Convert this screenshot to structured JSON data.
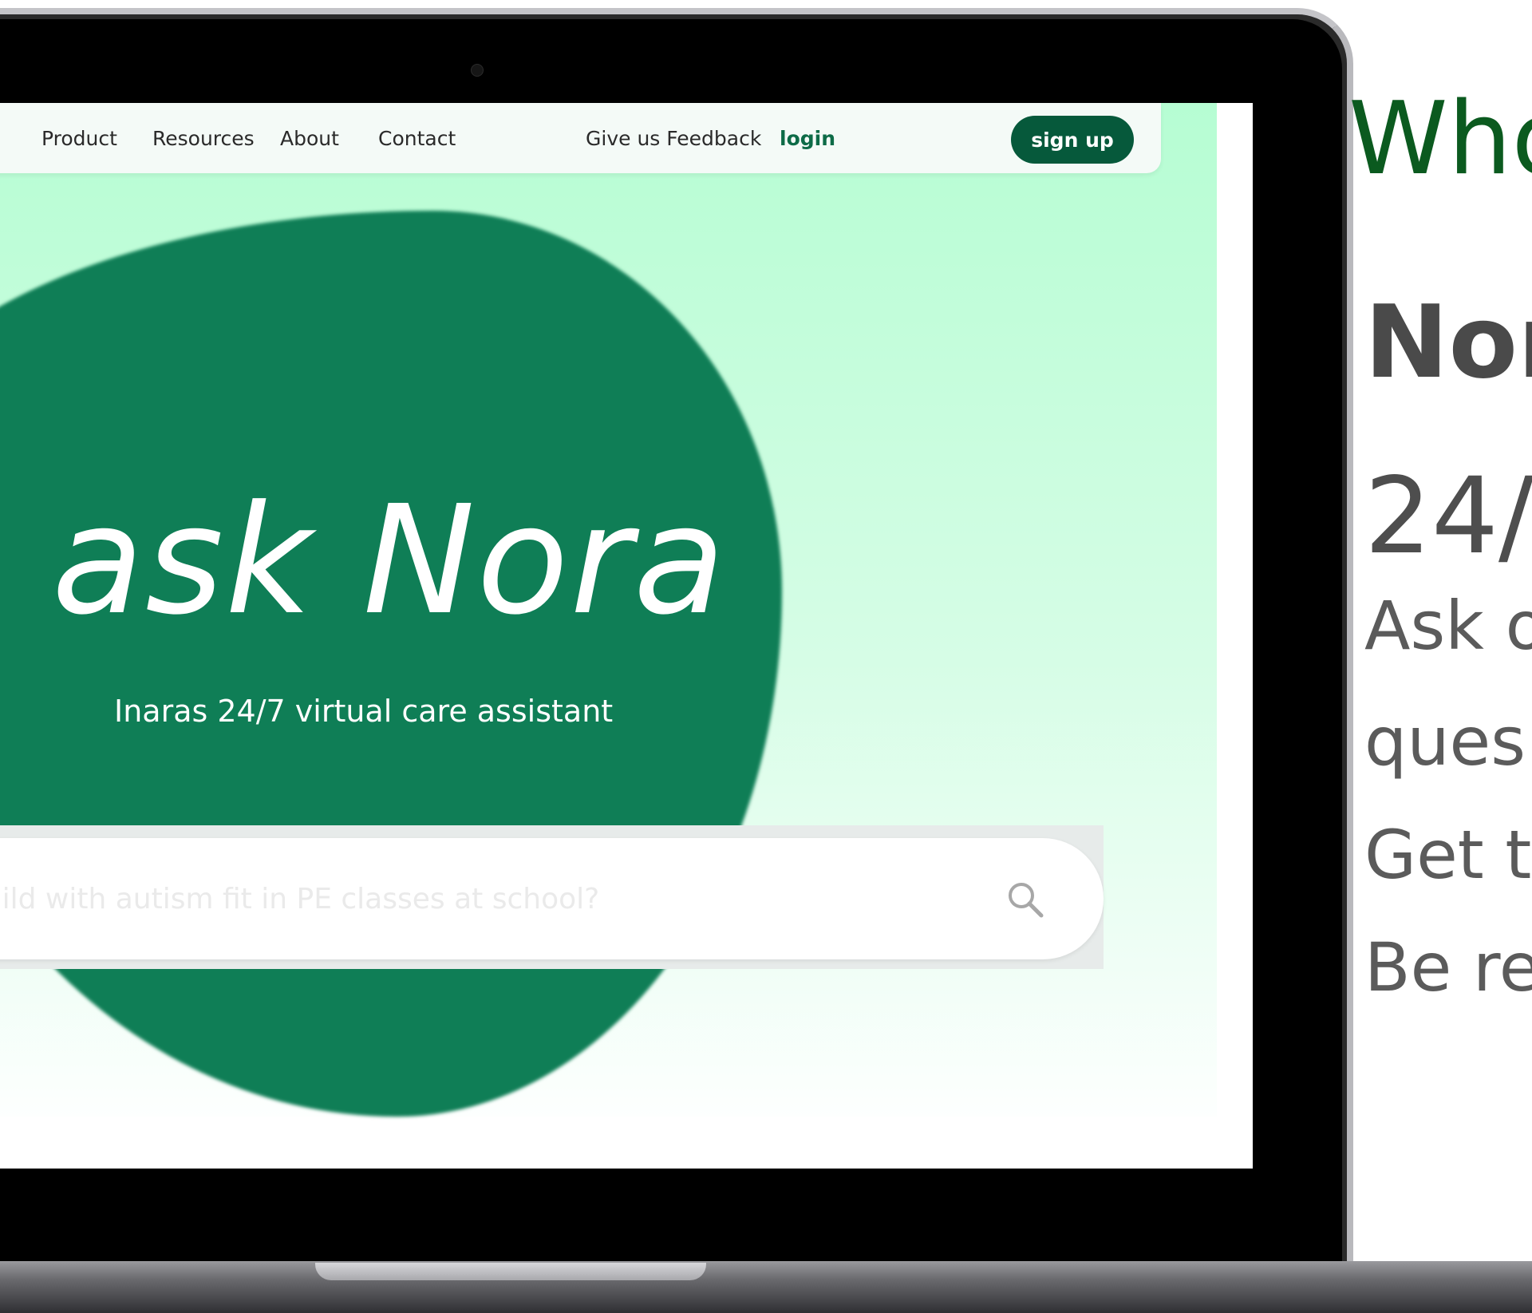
{
  "nav": {
    "product": "Product",
    "resources": "Resources",
    "about": "About",
    "contact": "Contact",
    "feedback": "Give us Feedback",
    "login": "login",
    "signup": "sign up"
  },
  "hero": {
    "title": "ask Nora",
    "subtitle": "Inaras 24/7 virtual care assistant"
  },
  "search": {
    "placeholder": "child with autism fit in PE classes at school?",
    "icon": "search-icon"
  },
  "side": {
    "heading": "Who",
    "name": "Nor",
    "line_247": "24/",
    "line_ask": "Ask o",
    "line_ques": "ques",
    "line_get": "Get t",
    "line_be": "Be re"
  },
  "colors": {
    "brand_green": "#0f7e56",
    "button_green": "#06593b",
    "heading_green": "#0b5a1f",
    "mint": "#b6fdd3"
  }
}
